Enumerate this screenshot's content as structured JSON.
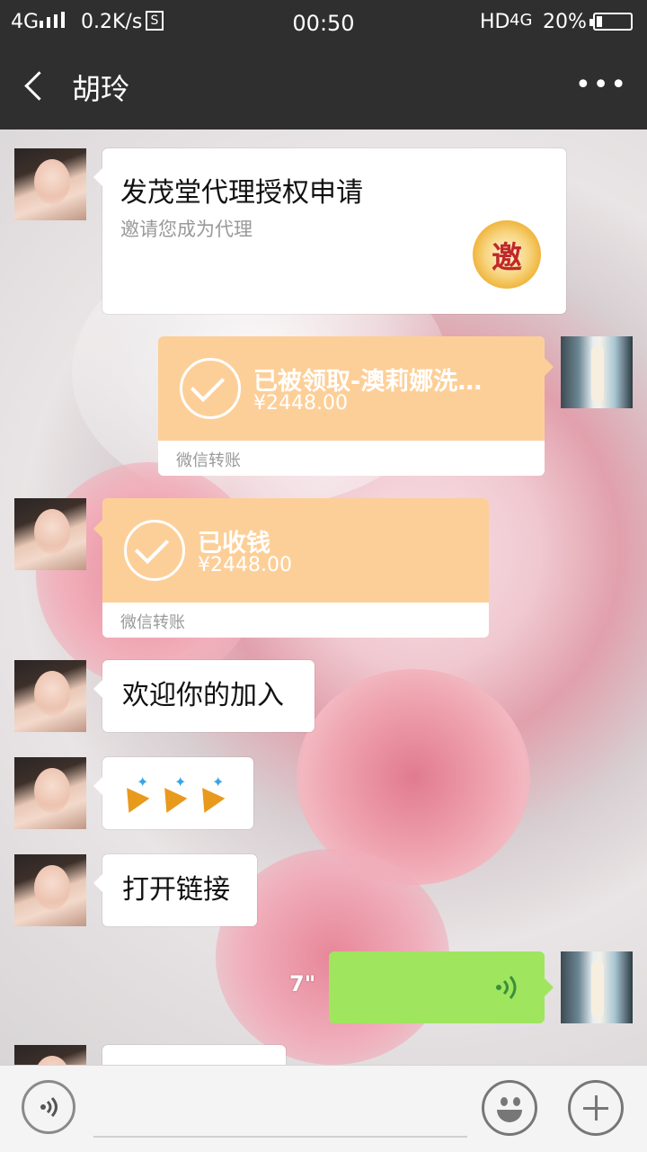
{
  "status_bar": {
    "network": "4G",
    "speed": "0.2K/s",
    "s_icon": "S",
    "time": "00:50",
    "hd": "HD",
    "network2": "4G",
    "battery": "20%"
  },
  "nav": {
    "title": "胡玲",
    "back_icon": "chevron-left-icon",
    "more_label": "•••"
  },
  "messages": {
    "invite_card": {
      "title": "发茂堂代理授权申请",
      "desc": "邀请您成为代理",
      "seal_text": "邀"
    },
    "transfer_sent": {
      "title": "已被领取-澳莉娜洗…",
      "amount": "¥2448.00",
      "footer": "微信转账"
    },
    "transfer_received": {
      "title": "已收钱",
      "amount": "¥2448.00",
      "footer": "微信转账"
    },
    "welcome": "欢迎你的加入",
    "open_link": "打开链接",
    "voice_duration": "7\""
  },
  "colors": {
    "header_bg": "#2f2f2f",
    "transfer_orange": "#fdcf98",
    "voice_green": "#9fe55e"
  },
  "input_bar": {
    "voice_icon": "voice-input-icon",
    "emoji_icon": "emoji-icon",
    "plus_icon": "plus-icon"
  }
}
